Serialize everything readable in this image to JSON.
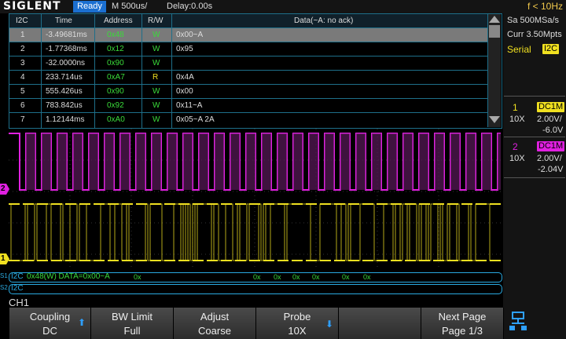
{
  "topbar": {
    "brand": "SIGLENT",
    "status": "Ready",
    "timebase": "M 500us/",
    "delay": "Delay:0.00s",
    "frequency": "f < 10Hz"
  },
  "table": {
    "headers": [
      "I2C",
      "Time",
      "Address",
      "R/W",
      "Data(~A: no ack)"
    ],
    "rows": [
      {
        "idx": "1",
        "time": "-3.49681ms",
        "addr": "0x48",
        "rw": "W",
        "data": "0x00~A"
      },
      {
        "idx": "2",
        "time": "-1.77368ms",
        "addr": "0x12",
        "rw": "W",
        "data": "0x95"
      },
      {
        "idx": "3",
        "time": "-32.0000ns",
        "addr": "0x90",
        "rw": "W",
        "data": ""
      },
      {
        "idx": "4",
        "time": "233.714us",
        "addr": "0xA7",
        "rw": "R",
        "data": "0x4A"
      },
      {
        "idx": "5",
        "time": "555.426us",
        "addr": "0x90",
        "rw": "W",
        "data": "0x00"
      },
      {
        "idx": "6",
        "time": "783.842us",
        "addr": "0x92",
        "rw": "W",
        "data": "0x11~A"
      },
      {
        "idx": "7",
        "time": "1.12144ms",
        "addr": "0xA0",
        "rw": "W",
        "data": "0x05~A 2A"
      }
    ]
  },
  "right_panel": {
    "sample_rate": "Sa 500MSa/s",
    "memory": "Curr 3.50Mpts",
    "serial_label": "Serial",
    "serial_protocol": "I2C",
    "ch1": {
      "num": "1",
      "coupling": "DC1M",
      "probe": "10X",
      "scale": "2.00V/",
      "offset": "-6.0V"
    },
    "ch2": {
      "num": "2",
      "coupling": "DC1M",
      "probe": "10X",
      "scale": "2.00V/",
      "offset": "-2.04V"
    }
  },
  "decode_bar": {
    "s1_label": "S1",
    "s1_prefix": "I2C",
    "s1_text": "0x48(W) DATA=0x00~A",
    "frames": [
      "0x",
      "0x",
      "0x",
      "0x",
      "0x",
      "0x",
      "0x"
    ],
    "s2_label": "S2",
    "s2_text": "I2C"
  },
  "markers": {
    "ch2": "2",
    "ch1": "1"
  },
  "menu_title": "CH1",
  "softkeys": [
    {
      "l1": "Coupling",
      "l2": "DC"
    },
    {
      "l1": "BW Limit",
      "l2": "Full"
    },
    {
      "l1": "Adjust",
      "l2": "Coarse"
    },
    {
      "l1": "Probe",
      "l2": "10X"
    },
    {
      "l1": "",
      "l2": ""
    },
    {
      "l1": "Next Page",
      "l2": "Page 1/3"
    }
  ],
  "colors": {
    "ch1": "#f0e020",
    "ch2": "#e020e0",
    "accent": "#2aa9e0",
    "address": "#3adb3a"
  }
}
